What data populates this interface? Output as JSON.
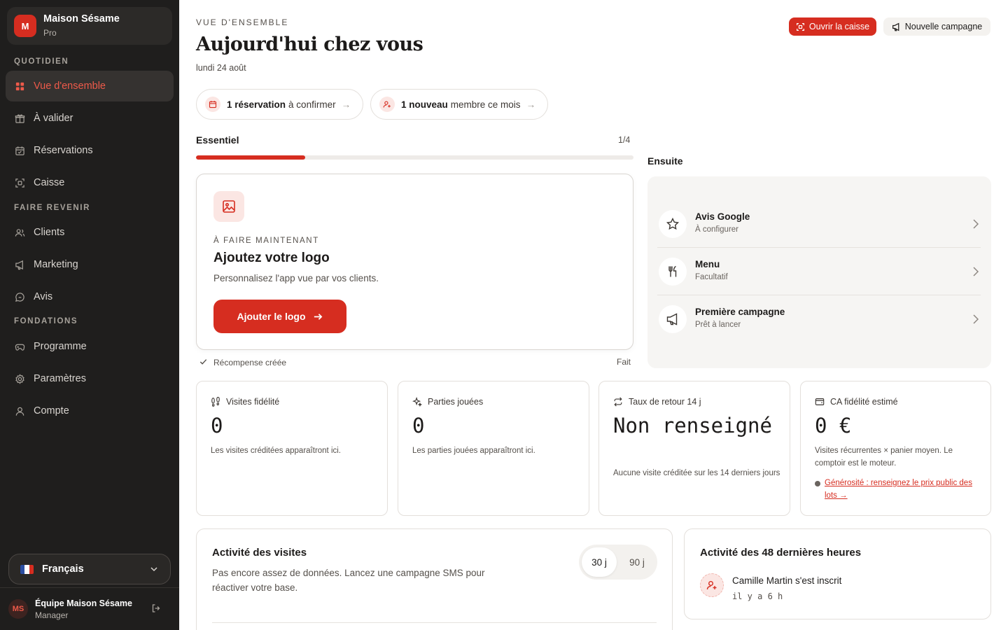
{
  "brand": {
    "initial": "M",
    "name": "Maison Sésame",
    "plan": "Pro"
  },
  "sidebar": {
    "sections": [
      "QUOTIDIEN",
      "FAIRE REVENIR",
      "FONDATIONS"
    ],
    "items": [
      {
        "label": "Vue d'ensemble",
        "icon": "grid-icon",
        "active": true
      },
      {
        "label": "À valider",
        "icon": "gift-icon"
      },
      {
        "label": "Réservations",
        "icon": "calendar-icon"
      },
      {
        "label": "Caisse",
        "icon": "scan-icon"
      },
      {
        "label": "Clients",
        "icon": "users-icon"
      },
      {
        "label": "Marketing",
        "icon": "megaphone-icon"
      },
      {
        "label": "Avis",
        "icon": "chat-icon"
      },
      {
        "label": "Programme",
        "icon": "gamepad-icon"
      },
      {
        "label": "Paramètres",
        "icon": "gear-icon"
      },
      {
        "label": "Compte",
        "icon": "user-icon"
      }
    ],
    "language": "Français",
    "user": {
      "initials": "MS",
      "name": "Équipe Maison Sésame",
      "role": "Manager"
    }
  },
  "header": {
    "eyebrow": "VUE D'ENSEMBLE",
    "title": "Aujourd'hui chez vous",
    "date": "lundi 24 août",
    "primary_button": "Ouvrir la caisse",
    "secondary_button": "Nouvelle campagne"
  },
  "pills": [
    {
      "bold": "1 réservation",
      "text": "à confirmer",
      "icon": "calendar-icon"
    },
    {
      "bold": "1 nouveau",
      "text": "membre ce mois",
      "icon": "user-plus-icon"
    }
  ],
  "essentiel": {
    "label": "Essentiel",
    "count": "1/4",
    "progress": 0.25,
    "task": {
      "eyebrow": "À FAIRE MAINTENANT",
      "title": "Ajoutez votre logo",
      "description": "Personnalisez l'app vue par vos clients.",
      "button": "Ajouter le logo"
    },
    "done": {
      "label": "Récompense créée",
      "status": "Fait"
    }
  },
  "ensuite": {
    "label": "Ensuite",
    "items": [
      {
        "title": "Avis Google",
        "subtitle": "À configurer",
        "icon": "star-icon"
      },
      {
        "title": "Menu",
        "subtitle": "Facultatif",
        "icon": "utensils-icon"
      },
      {
        "title": "Première campagne",
        "subtitle": "Prêt à lancer",
        "icon": "megaphone-icon"
      }
    ]
  },
  "stats": [
    {
      "label": "Visites fidélité",
      "value": "0",
      "note": "Les visites créditées apparaîtront ici.",
      "icon": "footprints-icon"
    },
    {
      "label": "Parties jouées",
      "value": "0",
      "note": "Les parties jouées apparaîtront ici.",
      "icon": "sparkle-icon"
    },
    {
      "label": "Taux de retour 14 j",
      "value": "Non renseigné",
      "note": "Aucune visite créditée sur les 14 derniers jours",
      "icon": "repeat-icon"
    },
    {
      "label": "CA fidélité estimé",
      "value": "0 €",
      "note": "Visites récurrentes × panier moyen. Le comptoir est le moteur.",
      "link": "Générosité : renseignez le prix public des lots →",
      "icon": "wallet-icon"
    }
  ],
  "activity": {
    "title": "Activité des visites",
    "description": "Pas encore assez de données. Lancez une campagne SMS pour réactiver votre base.",
    "range_options": [
      "30 j",
      "90 j"
    ],
    "selected_range": "30 j"
  },
  "recent": {
    "title": "Activité des 48 dernières heures",
    "items": [
      {
        "text": "Camille Martin s'est inscrit",
        "time": "il y a 6 h"
      }
    ]
  },
  "colors": {
    "accent": "#d62d20",
    "sidebar_bg": "#1f1e1d",
    "active_text": "#ee5a4a"
  }
}
